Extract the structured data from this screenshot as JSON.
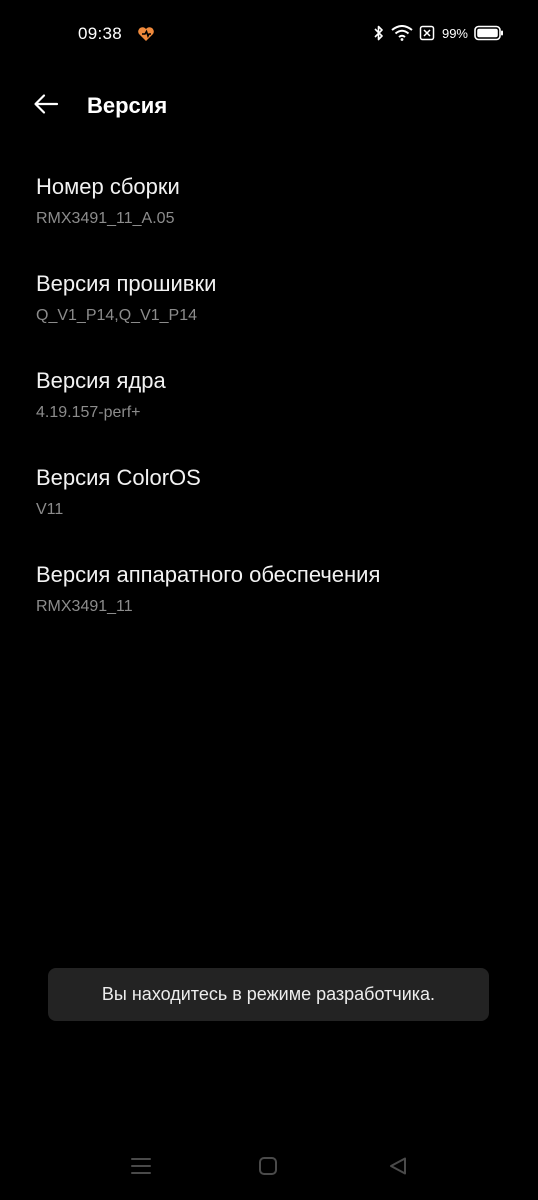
{
  "status_bar": {
    "time": "09:38",
    "battery": "99%",
    "icons": [
      "bluetooth-icon",
      "wifi-icon",
      "sim-off-icon",
      "battery-icon"
    ]
  },
  "header": {
    "title": "Версия",
    "back_icon": "back-arrow-icon"
  },
  "items": [
    {
      "title": "Номер сборки",
      "value": "RMX3491_11_A.05"
    },
    {
      "title": "Версия прошивки",
      "value": "Q_V1_P14,Q_V1_P14"
    },
    {
      "title": "Версия ядра",
      "value": "4.19.157-perf+"
    },
    {
      "title": "Версия ColorOS",
      "value": "V11"
    },
    {
      "title": "Версия аппаратного обеспечения",
      "value": "RMX3491_11"
    }
  ],
  "toast": {
    "text": "Вы находитесь в режиме разработчика."
  },
  "nav_bar": {
    "icons": [
      "recents-icon",
      "home-icon",
      "nav-back-icon"
    ]
  },
  "colors": {
    "background": "#000000",
    "accent": "#f08a3c",
    "secondary_text": "#8c8c8c",
    "toast_bg": "#232323"
  }
}
